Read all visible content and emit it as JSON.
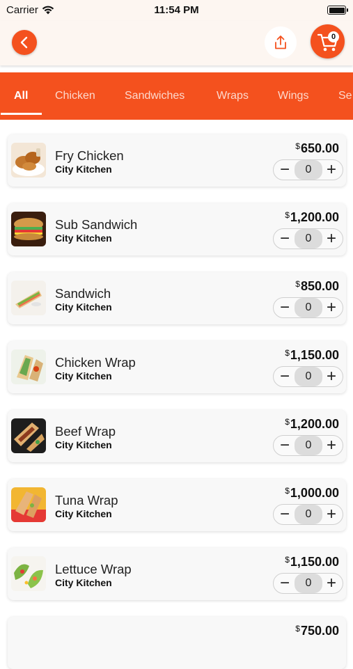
{
  "status_bar": {
    "carrier": "Carrier",
    "time": "11:54 PM"
  },
  "cart": {
    "count": "0"
  },
  "tabs": [
    {
      "label": "All"
    },
    {
      "label": "Chicken"
    },
    {
      "label": "Sandwiches"
    },
    {
      "label": "Wraps"
    },
    {
      "label": "Wings"
    },
    {
      "label": "Se"
    }
  ],
  "currency_symbol": "$",
  "items": [
    {
      "name": "Fry Chicken",
      "vendor": "City Kitchen",
      "price": "650.00",
      "qty": "0",
      "image": "fried-chicken"
    },
    {
      "name": "Sub Sandwich",
      "vendor": "City Kitchen",
      "price": "1,200.00",
      "qty": "0",
      "image": "sub-sandwich"
    },
    {
      "name": "Sandwich",
      "vendor": "City Kitchen",
      "price": "850.00",
      "qty": "0",
      "image": "sandwich"
    },
    {
      "name": "Chicken Wrap",
      "vendor": "City Kitchen",
      "price": "1,150.00",
      "qty": "0",
      "image": "chicken-wrap"
    },
    {
      "name": "Beef Wrap",
      "vendor": "City Kitchen",
      "price": "1,200.00",
      "qty": "0",
      "image": "beef-wrap"
    },
    {
      "name": "Tuna Wrap",
      "vendor": "City Kitchen",
      "price": "1,000.00",
      "qty": "0",
      "image": "tuna-wrap"
    },
    {
      "name": "Lettuce Wrap",
      "vendor": "City Kitchen",
      "price": "1,150.00",
      "qty": "0",
      "image": "lettuce-wrap"
    },
    {
      "name": "",
      "vendor": "",
      "price": "750.00",
      "qty": "",
      "image": ""
    }
  ],
  "stepper_symbols": {
    "minus": "−",
    "plus": "+"
  },
  "colors": {
    "accent": "#f4511e",
    "nav_background": "#fdf6f1"
  }
}
